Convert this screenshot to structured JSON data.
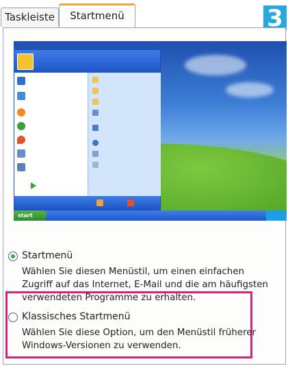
{
  "tabs": [
    {
      "label": "Taskleiste",
      "active": false
    },
    {
      "label": "Startmenü",
      "active": true
    }
  ],
  "step_badge": "3",
  "colors": {
    "badge": "#2aa7df",
    "active_tab_accent": "#f0a63a",
    "highlight_frame": "#d2237d",
    "radio_selected": "#3caa3c"
  },
  "preview": {
    "taskbar_start": "start"
  },
  "options": [
    {
      "title": "Startmenü",
      "selected": true,
      "description": "Wählen Sie diesen Menüstil, um einen einfachen Zugriff auf das Internet, E-Mail und die am häufigsten verwendeten Programme zu erhalten."
    },
    {
      "title": "Klassisches Startmenü",
      "selected": false,
      "description": "Wählen Sie diese Option, um den Menüstil früherer Windows-Versionen zu verwenden."
    }
  ]
}
